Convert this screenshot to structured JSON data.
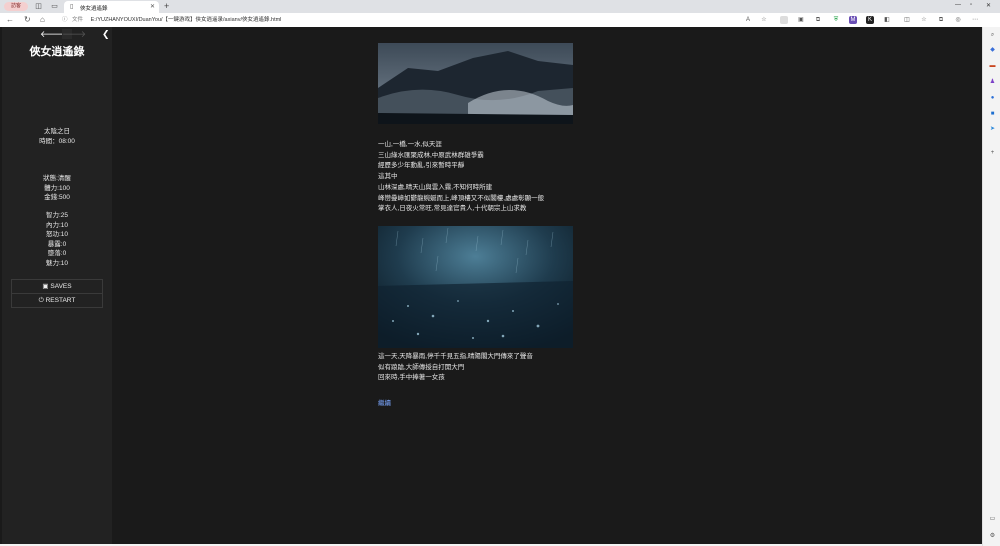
{
  "browser": {
    "guest_label": "訪客",
    "tab_title": "俠女逍遙錄",
    "url_info": "ⓘ",
    "url_file_label": "文件",
    "url": "E:/YUZHANYOUXI/DuanYou/【一鍵游戏】侠女逍遥录/axianv/俠女逍遙錄.html"
  },
  "sidebar": {
    "back_icon": "back-arrow",
    "forward_icon": "forward-arrow",
    "title": "俠女逍遙錄",
    "time_label": "太陰之日",
    "time_value": "時間：08:00",
    "status": "狀態:清醒",
    "stamina": "體力:100",
    "money": "金錢:500",
    "stats": [
      "智力:25",
      "內力:10",
      "怒功:10",
      "暴露:0",
      "墮落:0",
      "魅力:10"
    ],
    "saves_label": "SAVES",
    "restart_label": "RESTART"
  },
  "story": {
    "paragraph1": [
      "一山,一橋,一水,似天涯",
      "三山綠水匯聚成林,中原武林群雄爭霸",
      "經歷多少年動亂,引來暫時平靜",
      "這其中",
      "山林深處,晴天山與雲入霧,不知何時所建",
      "峰巒疊嶂如鬱龍蜿蜒而上,峰頂樓又不似閣樓,處處彰顯一般",
      "掌衣人,日夜火常旺,常見達官貴人,十代朝宗上山求教"
    ],
    "paragraph2": [
      "這一天,天降暴雨,停千千見五指,晴陽閣大門傳來了聲音",
      "似有踉蹌,大師傳授自打開大門",
      "回來時,手中捧著一女孩"
    ],
    "continue_link": "繼續"
  },
  "colors": {
    "page_bg": "#1a1a1a",
    "sidebar_bg": "#222222",
    "link": "#7aa6ff"
  }
}
